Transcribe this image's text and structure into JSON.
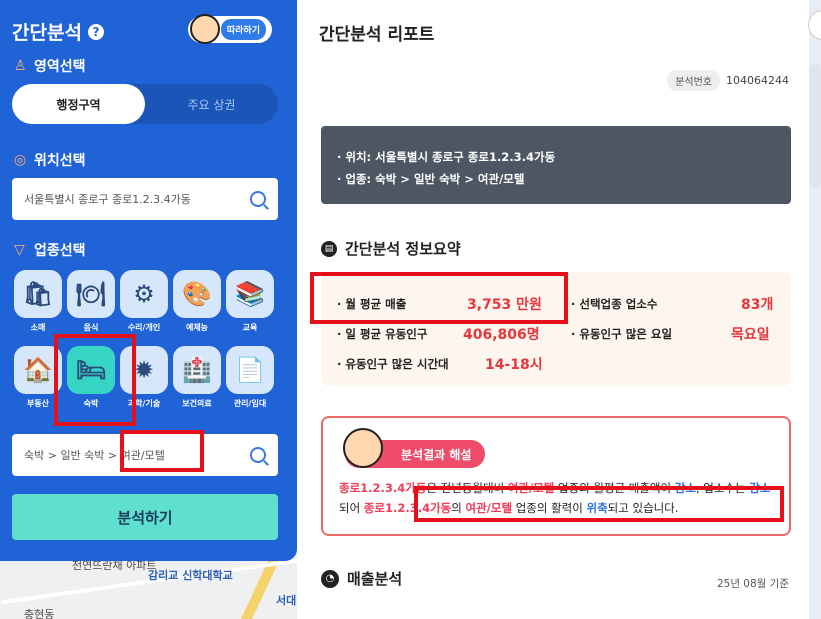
{
  "panel": {
    "title": "간단분석",
    "follow_label": "따라하기",
    "area_label": "영역선택",
    "tabs": [
      "행정구역",
      "주요 상권"
    ],
    "location_label": "위치선택",
    "location_value": "서울특별시 종로구 종로1.2.3.4가동",
    "industry_label": "업종선택",
    "categories": [
      "소매",
      "음식",
      "수리/개인",
      "예체능",
      "교육",
      "부동산",
      "숙박",
      "과학/기술",
      "보건의료",
      "관리/임대"
    ],
    "industry_value": "숙박 > 일반 숙박 > 여관/모텔",
    "analyze_label": "분석하기"
  },
  "map_labels": [
    "천연뜨란채 아파트",
    "감리교 신학대학교",
    "서대",
    "충현동"
  ],
  "report": {
    "title": "간단분석 리포트",
    "number_tag": "분석번호",
    "number": "104064244",
    "info_location": "· 위치: 서울특별시 종로구 종로1.2.3.4가동",
    "info_industry": "· 업종: 숙박 > 일반 숙박 > 여관/모텔",
    "summary_title": "간단분석 정보요약",
    "summary": [
      {
        "label": "· 월 평균 매출",
        "value": "3,753 만원"
      },
      {
        "label": "· 선택업종 업소수",
        "value": "83개"
      },
      {
        "label": "· 일 평균 유동인구",
        "value": "406,806명"
      },
      {
        "label": "· 유동인구 많은 요일",
        "value": "목요일"
      },
      {
        "label": "· 유동인구 많은 시간대",
        "value": "14-18시"
      }
    ],
    "interp_badge": "분석결과 해설",
    "interp": {
      "p1a": "종로1.2.3.4가동",
      "p1b": "은 전년동월대비 ",
      "p1c": "여관/모텔",
      "p1d": " 업종의 월평균 매출액이 ",
      "p1e": "감소",
      "p1f": ", 업소수는 ",
      "p1g": "감소",
      "p1h": "되어 ",
      "p1i": "종로1.2.3.4가동",
      "p1j": "의 ",
      "p1k": "여관/모텔",
      "p1l": " 업종의 활력이 ",
      "p1m": "위축",
      "p1n": "되고 있습니다."
    },
    "sales_title": "매출분석",
    "sales_date": "25년 08월 기준"
  }
}
